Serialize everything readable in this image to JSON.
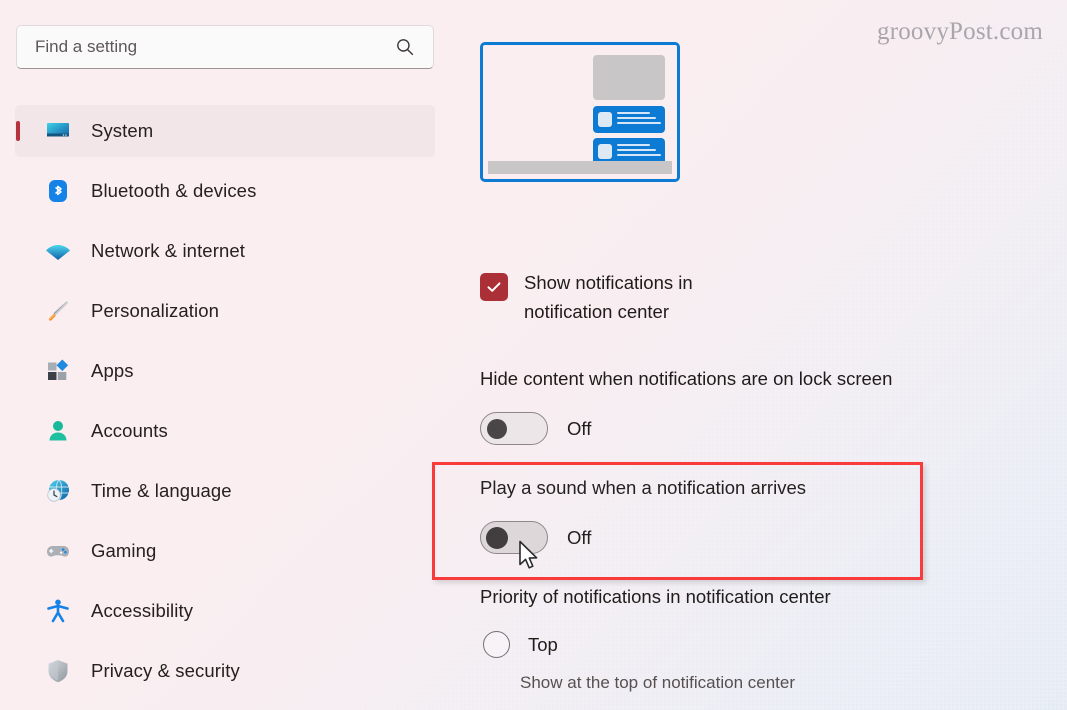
{
  "search": {
    "placeholder": "Find a setting",
    "value": "",
    "icon": "search-icon"
  },
  "sidebar": {
    "items": [
      {
        "label": "System",
        "icon": "monitor-icon",
        "selected": true
      },
      {
        "label": "Bluetooth & devices",
        "icon": "bluetooth-icon",
        "selected": false
      },
      {
        "label": "Network & internet",
        "icon": "wifi-icon",
        "selected": false
      },
      {
        "label": "Personalization",
        "icon": "paintbrush-icon",
        "selected": false
      },
      {
        "label": "Apps",
        "icon": "apps-grid-icon",
        "selected": false
      },
      {
        "label": "Accounts",
        "icon": "person-icon",
        "selected": false
      },
      {
        "label": "Time & language",
        "icon": "clock-globe-icon",
        "selected": false
      },
      {
        "label": "Gaming",
        "icon": "gamepad-icon",
        "selected": false
      },
      {
        "label": "Accessibility",
        "icon": "accessibility-icon",
        "selected": false
      },
      {
        "label": "Privacy & security",
        "icon": "shield-icon",
        "selected": false
      }
    ]
  },
  "main": {
    "preview": {
      "name": "notification-preview-illustration"
    },
    "checkbox_setting": {
      "label": "Show notifications in notification center",
      "checked": true
    },
    "settings": [
      {
        "title": "Hide content when notifications are on lock screen",
        "state": "Off",
        "on": false,
        "highlighted": false
      },
      {
        "title": "Play a sound when a notification arrives",
        "state": "Off",
        "on": false,
        "highlighted": true
      }
    ],
    "priority": {
      "title": "Priority of notifications in notification center",
      "option_label": "Top",
      "option_description": "Show at the top of notification center",
      "selected": false
    }
  },
  "watermark": {
    "text": "groovyPost.com"
  },
  "colors": {
    "accent_blue": "#0d7ad4",
    "checkbox_red": "#ab2f36",
    "selection_pill": "#b4333e",
    "highlight_box": "#f93b3b",
    "text_primary": "#201c1b",
    "text_secondary": "#56504f"
  }
}
